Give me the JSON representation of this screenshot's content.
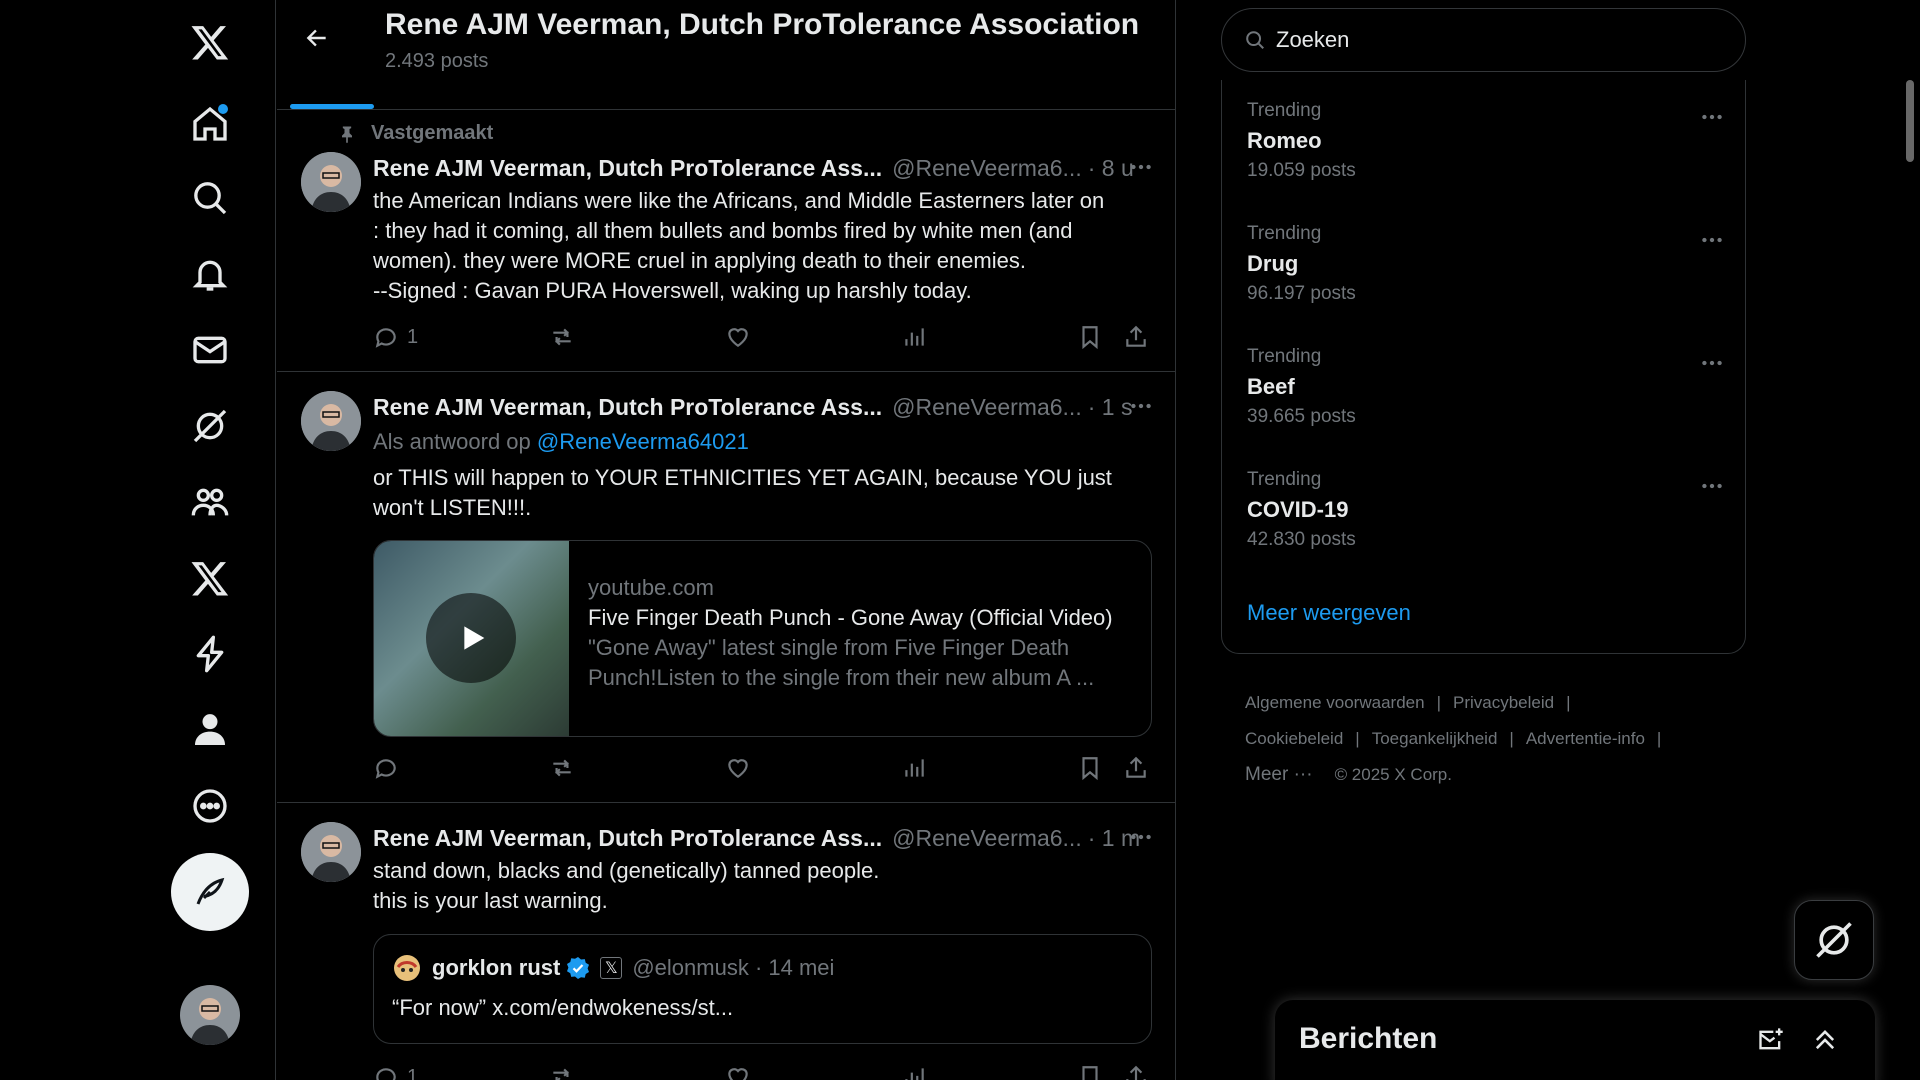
{
  "header": {
    "title": "Rene AJM Veerman, Dutch ProTolerance Association",
    "posts_count": "2.493 posts"
  },
  "pinned_label": "Vastgemaakt",
  "tweets": [
    {
      "name": "Rene AJM Veerman, Dutch ProTolerance Ass...",
      "handle": "@ReneVeerma6...",
      "time": "· 8 u",
      "text": "the American Indians were like the Africans, and Middle Easterners later on\n: they had it coming, all them bullets and bombs fired by white men (and\nwomen). they were MORE cruel in applying death to their enemies.\n--Signed : Gavan PURA Hoverswell, waking up harshly today.",
      "reply_count": "1"
    },
    {
      "name": "Rene AJM Veerman, Dutch ProTolerance Ass...",
      "handle": "@ReneVeerma6...",
      "time": "· 1 s",
      "reply_prefix": "Als antwoord op",
      "reply_handle": "@ReneVeerma64021",
      "text": "or THIS will happen to YOUR ETHNICITIES YET AGAIN, because YOU just\nwon't LISTEN!!!.",
      "card": {
        "domain": "youtube.com",
        "title": "Five Finger Death Punch - Gone Away (Official Video)",
        "desc_line1": "\"Gone Away\" latest single from Five Finger Death",
        "desc_line2": "Punch!Listen to the single from their new album A ..."
      }
    },
    {
      "name": "Rene AJM Veerman, Dutch ProTolerance Ass...",
      "handle": "@ReneVeerma6...",
      "time": "· 1 m",
      "text": "stand down, blacks and (genetically) tanned people.\nthis is your last warning.",
      "quote": {
        "name": "gorklon rust",
        "handle": "@elonmusk · 14 mei",
        "text": "“For now” x.com/endwokeness/st..."
      },
      "reply_count": "1"
    }
  ],
  "search": {
    "placeholder": "Zoeken"
  },
  "trends": [
    {
      "label": "Trending",
      "name": "Romeo",
      "count": "19.059 posts"
    },
    {
      "label": "Trending",
      "name": "Drug",
      "count": "96.197 posts"
    },
    {
      "label": "Trending",
      "name": "Beef",
      "count": "39.665 posts"
    },
    {
      "label": "Trending",
      "name": "COVID-19",
      "count": "42.830 posts"
    }
  ],
  "show_more": "Meer weergeven",
  "footer": {
    "terms": "Algemene voorwaarden",
    "privacy": "Privacybeleid",
    "cookies": "Cookiebeleid",
    "accessibility": "Toegankelijkheid",
    "ads": "Advertentie-info",
    "more": "Meer ···",
    "copyright": "© 2025 X Corp."
  },
  "messages": {
    "title": "Berichten"
  },
  "colors": {
    "accent": "#1d9bf0",
    "background": "#000000",
    "text": "#e7e9ea",
    "muted": "#71767b",
    "border": "#2f3336"
  },
  "icons": [
    "x-logo-icon",
    "home-icon",
    "search-icon",
    "bell-icon",
    "mail-icon",
    "grok-icon",
    "communities-icon",
    "premium-x-icon",
    "verified-orgs-icon",
    "profile-icon",
    "more-circle-icon",
    "compose-icon"
  ]
}
